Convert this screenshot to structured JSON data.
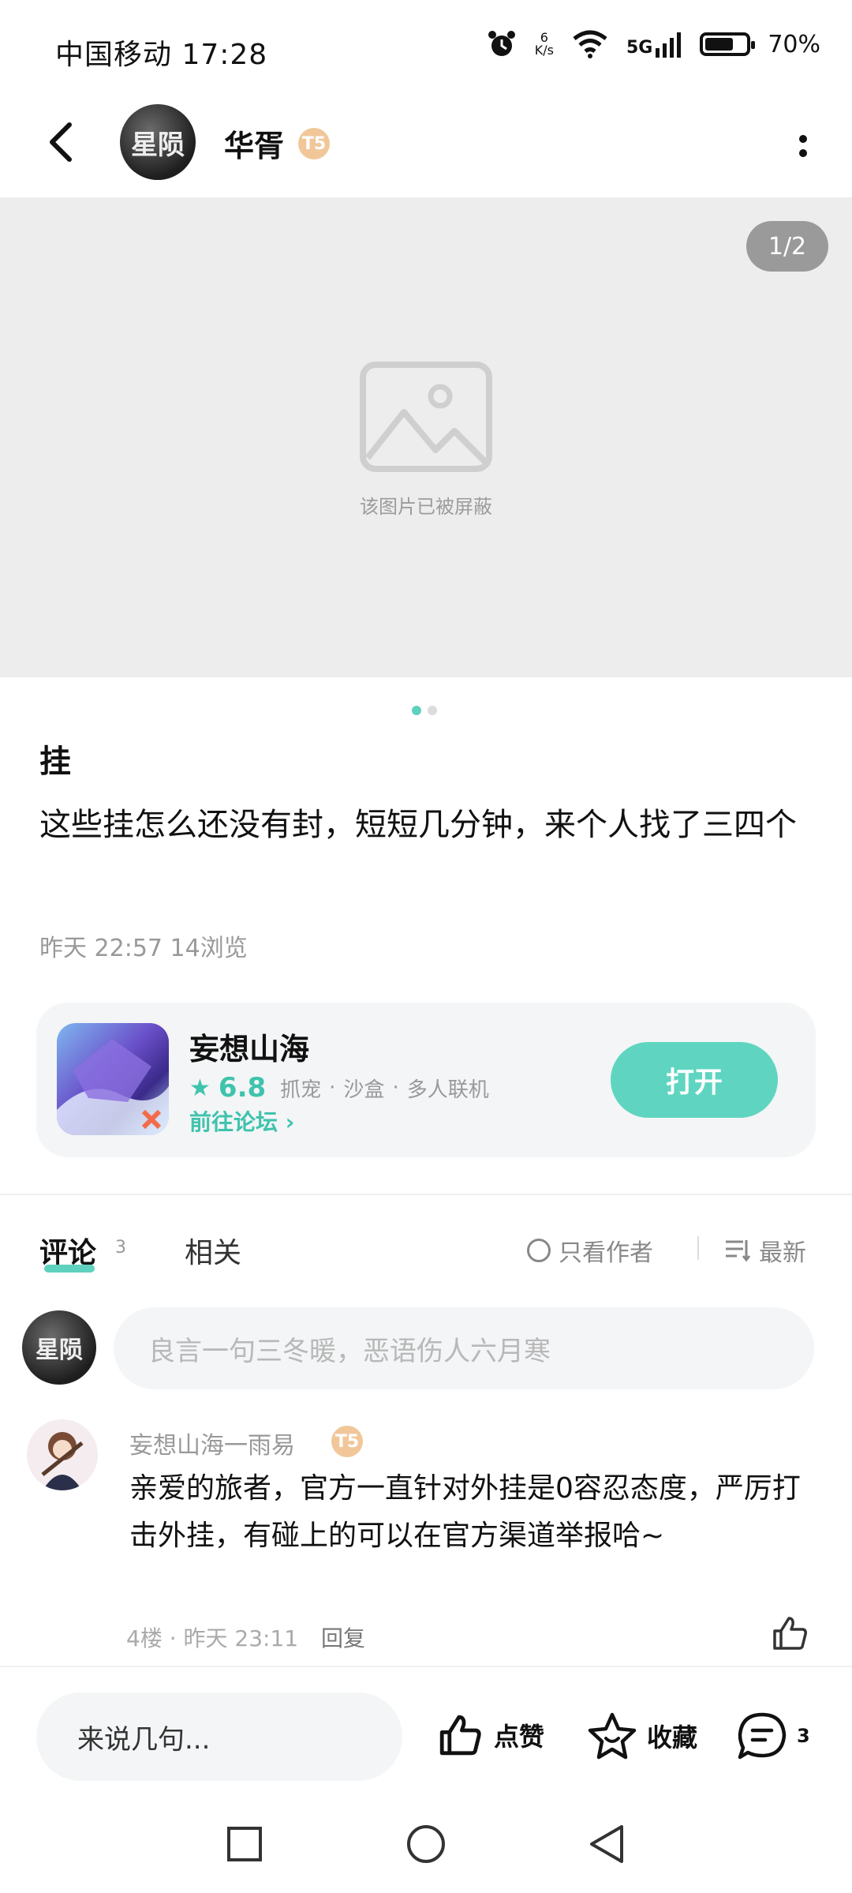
{
  "status_bar": {
    "carrier_time": "中国移动 17:28",
    "net_speed_value": "6",
    "net_speed_unit": "K/s",
    "network": "5G",
    "battery_pct": "70%",
    "battery_level": 0.7
  },
  "header": {
    "avatar_text": "星陨",
    "username": "华胥",
    "level_badge": "T5"
  },
  "gallery": {
    "counter": "1/2",
    "blocked_text": "该图片已被屏蔽"
  },
  "post": {
    "title": "挂",
    "body": "这些挂怎么还没有封，短短几分钟，来个人找了三四个",
    "meta": "昨天 22:57  14浏览"
  },
  "game_card": {
    "name": "妄想山海",
    "score": "6.8",
    "tags": [
      "抓宠",
      "沙盒",
      "多人联机"
    ],
    "forum_link": "前往论坛",
    "open_label": "打开"
  },
  "tabs": {
    "comments_label": "评论",
    "comments_count": "3",
    "related_label": "相关",
    "only_author": "只看作者",
    "sort": "最新"
  },
  "comment_input": {
    "avatar_text": "星陨",
    "placeholder": "良言一句三冬暖，恶语伤人六月寒"
  },
  "comment": {
    "name": "妄想山海一雨易",
    "badge": "T5",
    "text": "亲爱的旅者，官方一直针对外挂是0容忍态度，严厉打击外挂，有碰上的可以在官方渠道举报哈~",
    "floor_time": "4楼 · 昨天 23:11",
    "reply": "回复"
  },
  "bottom_bar": {
    "input_placeholder": "来说几句...",
    "like": "点赞",
    "collect": "收藏",
    "comment_count": "3"
  }
}
